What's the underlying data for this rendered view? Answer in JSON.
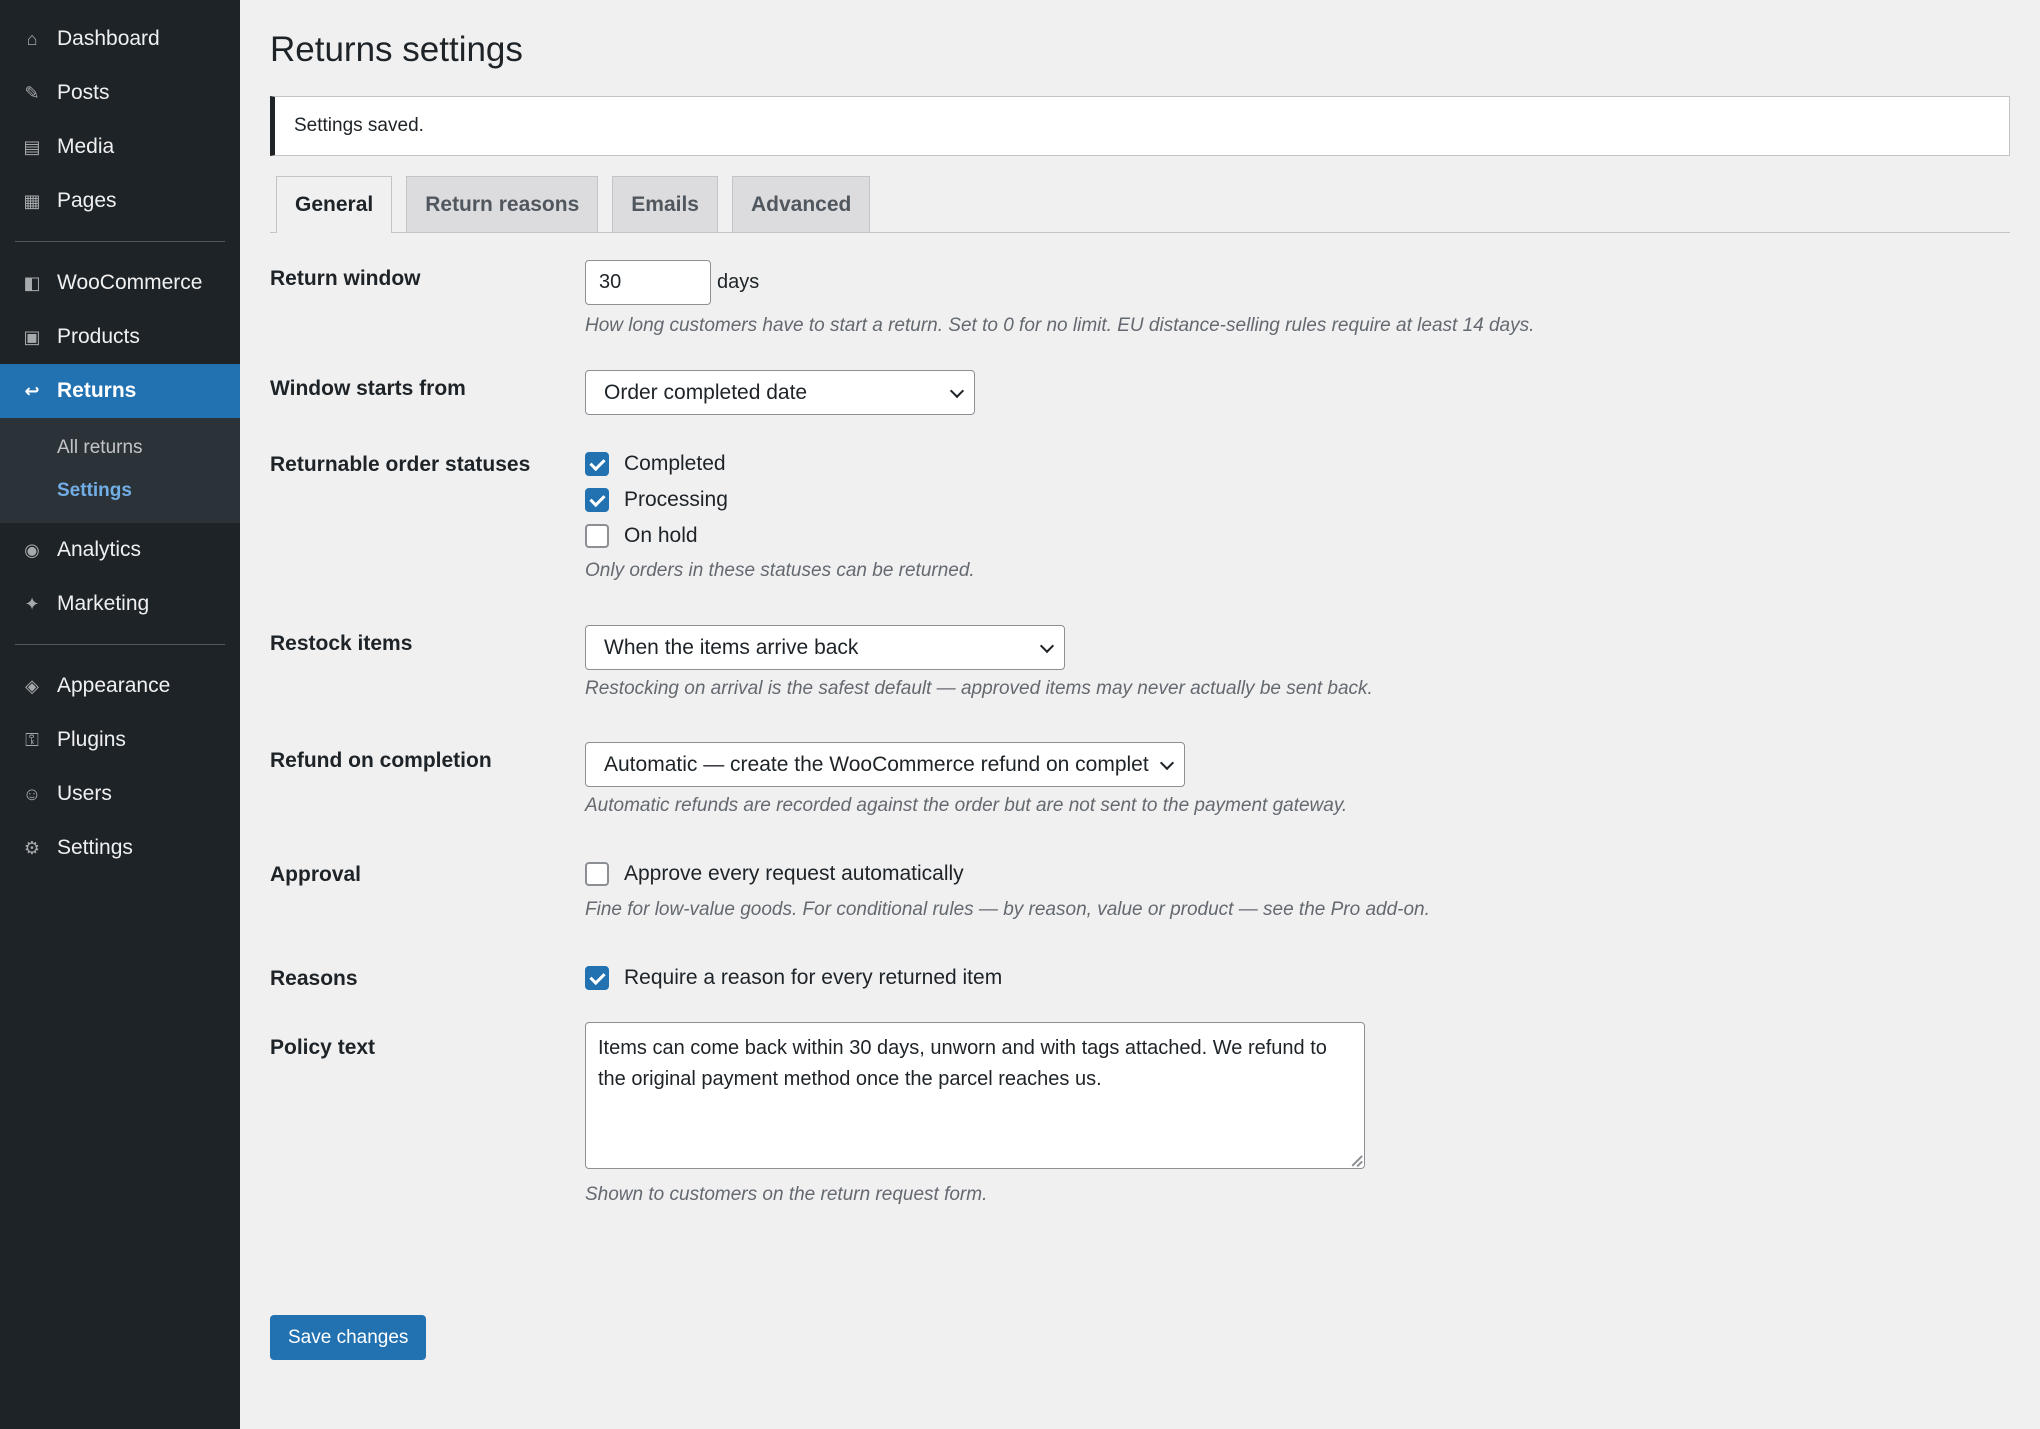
{
  "sidebar": {
    "items": [
      {
        "label": "Dashboard",
        "icon": "dashboard-icon",
        "glyph": "⌂"
      },
      {
        "label": "Posts",
        "icon": "posts-icon",
        "glyph": "✎"
      },
      {
        "label": "Media",
        "icon": "media-icon",
        "glyph": "▤"
      },
      {
        "label": "Pages",
        "icon": "pages-icon",
        "glyph": "▦"
      },
      {
        "label": "WooCommerce",
        "icon": "woocommerce-icon",
        "glyph": "◧"
      },
      {
        "label": "Products",
        "icon": "products-icon",
        "glyph": "▣"
      },
      {
        "label": "Returns",
        "icon": "returns-icon",
        "glyph": "↩"
      },
      {
        "label": "Analytics",
        "icon": "analytics-icon",
        "glyph": "◉"
      },
      {
        "label": "Marketing",
        "icon": "marketing-icon",
        "glyph": "✦"
      },
      {
        "label": "Appearance",
        "icon": "appearance-icon",
        "glyph": "◈"
      },
      {
        "label": "Plugins",
        "icon": "plugins-icon",
        "glyph": "⚿"
      },
      {
        "label": "Users",
        "icon": "users-icon",
        "glyph": "☺"
      },
      {
        "label": "Settings",
        "icon": "settings-icon",
        "glyph": "⚙"
      }
    ],
    "submenu": [
      {
        "label": "All returns"
      },
      {
        "label": "Settings"
      }
    ]
  },
  "page": {
    "title": "Returns settings",
    "notice": "Settings saved."
  },
  "tabs": [
    "General",
    "Return reasons",
    "Emails",
    "Advanced"
  ],
  "form": {
    "return_window": {
      "label": "Return window",
      "value": "30",
      "suffix": "days",
      "description": "How long customers have to start a return. Set to 0 for no limit. EU distance-selling rules require at least 14 days."
    },
    "window_start": {
      "label": "Window starts from",
      "selected": "Order completed date"
    },
    "statuses": {
      "label": "Returnable order statuses",
      "options": [
        {
          "label": "Completed",
          "checked": true
        },
        {
          "label": "Processing",
          "checked": true
        },
        {
          "label": "On hold",
          "checked": false
        }
      ],
      "description": "Only orders in these statuses can be returned."
    },
    "restock": {
      "label": "Restock items",
      "selected": "When the items arrive back",
      "description": "Restocking on arrival is the safest default — approved items may never actually be sent back."
    },
    "refund": {
      "label": "Refund on completion",
      "selected": "Automatic — create the WooCommerce refund on complet",
      "description": "Automatic refunds are recorded against the order but are not sent to the payment gateway."
    },
    "approval": {
      "label": "Approval",
      "checkbox_label": "Approve every request automatically",
      "checked": false,
      "description": "Fine for low-value goods. For conditional rules — by reason, value or product — see the Pro add-on."
    },
    "reasons": {
      "label": "Reasons",
      "checkbox_label": "Require a reason for every returned item",
      "checked": true
    },
    "policy": {
      "label": "Policy text",
      "value": "Items can come back within 30 days, unworn and with tags attached. We refund to the original payment method once the parcel reaches us.",
      "description": "Shown to customers on the return request form."
    }
  },
  "save_label": "Save changes",
  "colors": {
    "accent": "#2271b1",
    "sidebar_bg": "#1d2327",
    "page_bg": "#f0f0f1"
  }
}
